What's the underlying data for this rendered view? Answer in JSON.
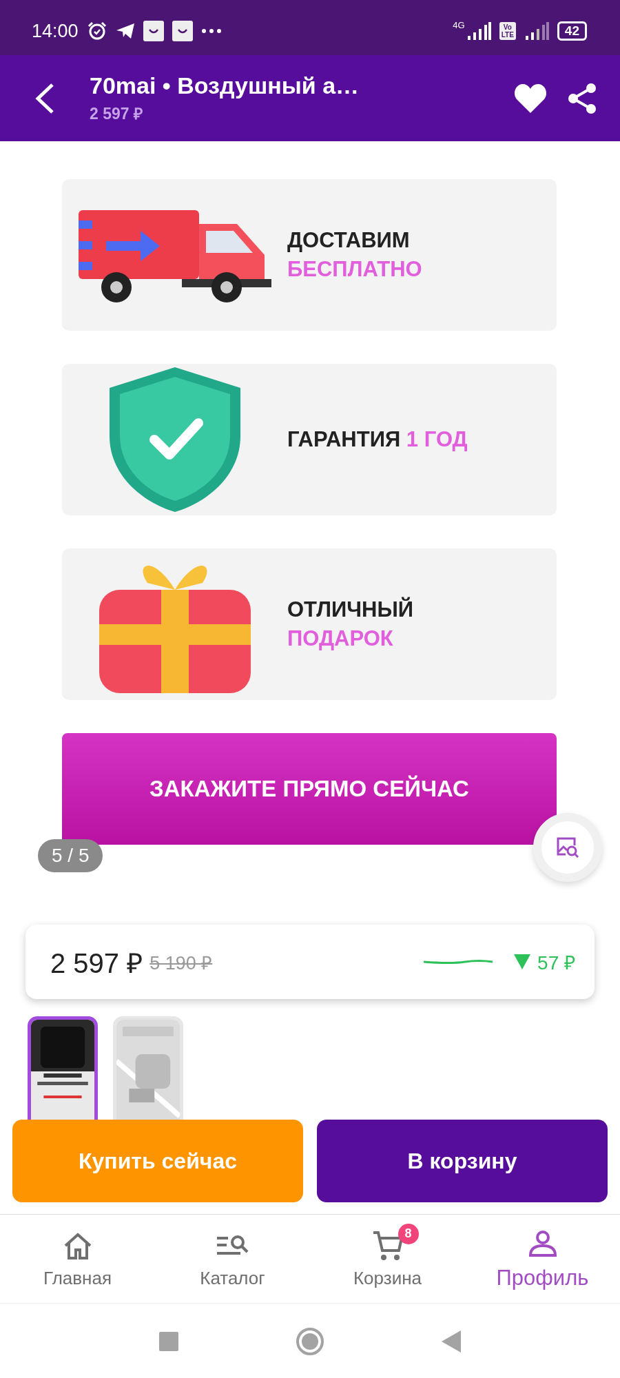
{
  "status_bar": {
    "time": "14:00",
    "network": "4G",
    "volte": [
      "Vo",
      "LTE"
    ],
    "battery": "42"
  },
  "header": {
    "title": "70mai • Воздушный а…",
    "price": "2 597 ₽"
  },
  "gallery": {
    "cards": [
      {
        "kind": "truck",
        "lines": [
          [
            {
              "text": "ДОСТАВИМ",
              "accent": false
            }
          ],
          [
            {
              "text": "БЕСПЛАТНО",
              "accent": true
            }
          ]
        ]
      },
      {
        "kind": "shield",
        "lines": [
          [
            {
              "text": "ГАРАНТИЯ",
              "accent": false
            },
            {
              "text": "1 ГОД",
              "accent": true
            }
          ]
        ]
      },
      {
        "kind": "gift",
        "lines": [
          [
            {
              "text": "ОТЛИЧНЫЙ",
              "accent": false
            }
          ],
          [
            {
              "text": "ПОДАРОК",
              "accent": true
            }
          ]
        ]
      }
    ],
    "cta": "ЗАКАЖИТЕ ПРЯМО СЕЙЧАС",
    "counter": "5 / 5"
  },
  "price_card": {
    "price": "2 597 ₽",
    "old_price": "5 190 ₽",
    "change": "57 ₽"
  },
  "thumbnails": [
    {
      "selected": true
    },
    {
      "selected": false
    }
  ],
  "buttons": {
    "buy": "Купить сейчас",
    "cart": "В корзину"
  },
  "nav": [
    {
      "kind": "home",
      "label": "Главная",
      "selected": false
    },
    {
      "kind": "catalog",
      "label": "Каталог",
      "selected": false
    },
    {
      "kind": "cart",
      "label": "Корзина",
      "selected": false,
      "badge": "8"
    },
    {
      "kind": "profile",
      "label": "Профиль",
      "selected": true
    }
  ]
}
